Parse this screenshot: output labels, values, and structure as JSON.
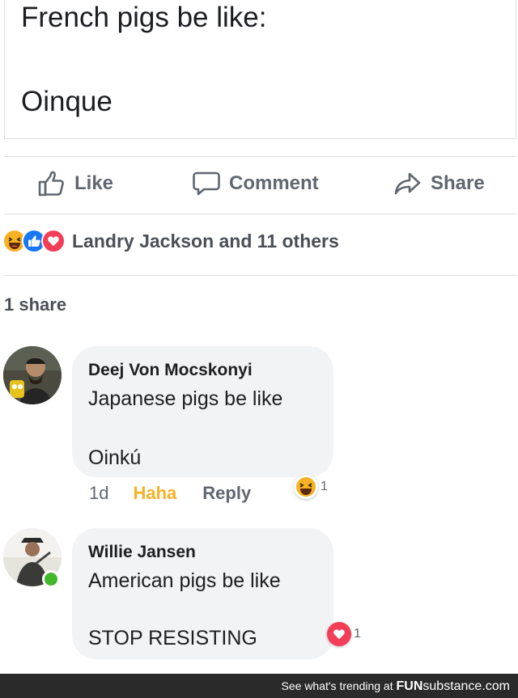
{
  "post": {
    "line1": "French pigs be like:",
    "line2": "Oinque"
  },
  "actions": {
    "like": "Like",
    "comment": "Comment",
    "share": "Share"
  },
  "reactions": {
    "names": "Landry Jackson and 11 others",
    "icons": [
      "haha-icon",
      "like-icon",
      "love-icon"
    ]
  },
  "shares": "1 share",
  "comments": [
    {
      "author": "Deej Von Mocskonyi",
      "line1": "Japanese pigs be like",
      "line2": "Oinkú",
      "time": "1d",
      "haha": "Haha",
      "reply": "Reply",
      "reaction_icon": "haha-icon",
      "reaction_count": "1"
    },
    {
      "author": "Willie Jansen",
      "line1": "American pigs be like",
      "line2": "STOP RESISTING",
      "reaction_icon": "love-icon",
      "reaction_count": "1"
    }
  ],
  "footer": {
    "prefix": "See what's trending at",
    "brand_bold": "FUN",
    "brand_rest": "substance.com"
  },
  "colors": {
    "action_grey": "#606770",
    "haha_yellow": "#f7b125",
    "like_blue": "#1877f2",
    "love_red": "#f33e58",
    "online_green": "#42b72a",
    "footer_bg": "#2a2a2a"
  }
}
